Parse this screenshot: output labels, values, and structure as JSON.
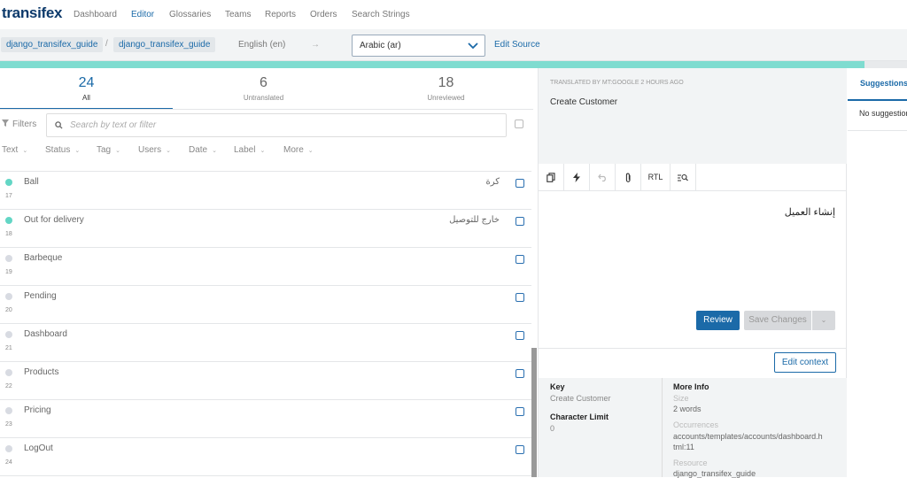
{
  "nav": {
    "logo": "transifex",
    "items": [
      "Dashboard",
      "Editor",
      "Glossaries",
      "Teams",
      "Reports",
      "Orders",
      "Search Strings"
    ],
    "active": "Editor"
  },
  "subbar": {
    "breadcrumbs": [
      "django_transifex_guide",
      "django_transifex_guide"
    ],
    "separator": "/",
    "source_language": "English (en)",
    "arrow": "→",
    "target_language": "Arabic (ar)",
    "edit_source": "Edit Source"
  },
  "progress_fraction": 0.953,
  "tabs": [
    {
      "count": "24",
      "label": "All"
    },
    {
      "count": "6",
      "label": "Untranslated"
    },
    {
      "count": "18",
      "label": "Unreviewed"
    }
  ],
  "filters_label": "Filters",
  "search_placeholder": "Search by text or filter",
  "filter_chips": [
    "Text",
    "Status",
    "Tag",
    "Users",
    "Date",
    "Label",
    "More"
  ],
  "rows": [
    {
      "source": "Ball",
      "num": "17",
      "translation": "كرة",
      "translated": true
    },
    {
      "source": "Out for delivery",
      "num": "18",
      "translation": "خارج للتوصيل",
      "translated": true
    },
    {
      "source": "Barbeque",
      "num": "19",
      "translation": "",
      "translated": false
    },
    {
      "source": "Pending",
      "num": "20",
      "translation": "",
      "translated": false
    },
    {
      "source": "Dashboard",
      "num": "21",
      "translation": "",
      "translated": false
    },
    {
      "source": "Products",
      "num": "22",
      "translation": "",
      "translated": false
    },
    {
      "source": "Pricing",
      "num": "23",
      "translation": "",
      "translated": false
    },
    {
      "source": "LogOut",
      "num": "24",
      "translation": "",
      "translated": false
    }
  ],
  "editor": {
    "translated_by": "TRANSLATED BY MT:GOOGLE 2 HOURS AGO",
    "source_text": "Create Customer",
    "toolbar_rtl": "RTL",
    "translation": "إنشاء العميل",
    "review_button": "Review",
    "save_button": "Save Changes",
    "edit_context_button": "Edit context"
  },
  "info": {
    "key_label": "Key",
    "key_value": "Create Customer",
    "char_limit_label": "Character Limit",
    "char_limit_value": "0",
    "more_info_label": "More Info",
    "size_label": "Size",
    "size_value": "2 words",
    "occurrences_label": "Occurrences",
    "occurrences_line1": "accounts/templates/accounts/dashboard.h",
    "occurrences_line2": "tml:11",
    "resource_label": "Resource",
    "resource_value": "django_transifex_guide"
  },
  "suggestions": {
    "tab_label": "Suggestions",
    "empty_text": "No suggestions"
  },
  "colors": {
    "brand": "#0d3a6b",
    "accent": "#1b6aa8",
    "translated_dot": "#63d6c5",
    "progress": "#7fdcd0"
  }
}
